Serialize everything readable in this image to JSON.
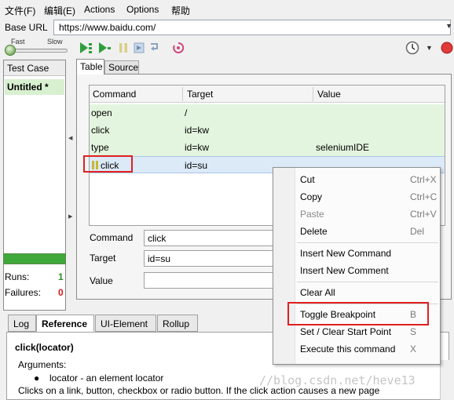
{
  "menubar": {
    "items": [
      {
        "label": "文件(F)"
      },
      {
        "label": "编辑(E)"
      },
      {
        "label": "Actions"
      },
      {
        "label": "Options"
      },
      {
        "label": "帮助"
      }
    ]
  },
  "base_url": {
    "label": "Base URL",
    "value": "https://www.baidu.com/"
  },
  "toolbar": {
    "speed_fast": "Fast",
    "speed_slow": "Slow",
    "icons": [
      "play-all-icon",
      "play-current-icon",
      "pause-icon",
      "step-icon",
      "rollup-icon",
      "record-icon",
      "schedule-clock-icon",
      "record-button-icon"
    ]
  },
  "test_case_panel": {
    "header": "Test Case",
    "selected_case": "Untitled *",
    "runs_label": "Runs:",
    "runs_value": "1",
    "failures_label": "Failures:",
    "failures_value": "0",
    "progress_color": "#3fa83a",
    "progress_fraction": 1.0
  },
  "main": {
    "tabs": [
      {
        "label": "Table",
        "active": true
      },
      {
        "label": "Source",
        "active": false
      }
    ],
    "table": {
      "columns": [
        "Command",
        "Target",
        "Value"
      ],
      "rows": [
        {
          "command": "open",
          "target": "/",
          "value": ""
        },
        {
          "command": "click",
          "target": "id=kw",
          "value": ""
        },
        {
          "command": "type",
          "target": "id=kw",
          "value": "seleniumIDE"
        },
        {
          "command": "click",
          "target": "id=su",
          "value": "",
          "selected": true,
          "breakpoint": true
        }
      ]
    },
    "editor": {
      "command_label": "Command",
      "command_value": "click",
      "target_label": "Target",
      "target_value": "id=su",
      "value_label": "Value",
      "value_value": ""
    }
  },
  "bottom": {
    "tabs": [
      {
        "label": "Log",
        "active": false
      },
      {
        "label": "Reference",
        "active": true
      },
      {
        "label": "UI-Element",
        "active": false
      },
      {
        "label": "Rollup",
        "active": false
      }
    ],
    "reference": {
      "title": "click(locator)",
      "arguments_label": "Arguments:",
      "argument_text": "locator - an element locator",
      "description": "Clicks on a link, button, checkbox or radio button. If the click action causes a new page"
    }
  },
  "context_menu": {
    "items": [
      {
        "label": "Cut",
        "shortcut": "Ctrl+X",
        "enabled": true
      },
      {
        "label": "Copy",
        "shortcut": "Ctrl+C",
        "enabled": true
      },
      {
        "label": "Paste",
        "shortcut": "Ctrl+V",
        "enabled": false
      },
      {
        "label": "Delete",
        "shortcut": "Del",
        "enabled": true
      },
      {
        "label": "Insert New Command",
        "shortcut": "",
        "enabled": true
      },
      {
        "label": "Insert New Comment",
        "shortcut": "",
        "enabled": true
      },
      {
        "label": "Clear All",
        "shortcut": "",
        "enabled": true
      },
      {
        "label": "Toggle Breakpoint",
        "shortcut": "B",
        "enabled": true,
        "highlighted": true
      },
      {
        "label": "Set / Clear Start Point",
        "shortcut": "S",
        "enabled": true
      },
      {
        "label": "Execute this command",
        "shortcut": "X",
        "enabled": true
      }
    ]
  },
  "watermark": "//blog.csdn.net/heve13",
  "colors": {
    "annotation_red": "#e02020",
    "row_green": "#e4f5df",
    "selected_blue": "#dceaf8",
    "progress_green": "#3fa83a"
  }
}
